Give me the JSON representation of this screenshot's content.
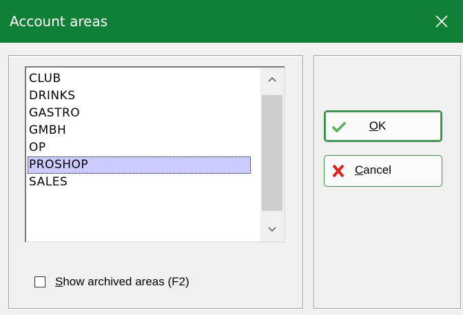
{
  "window": {
    "title": "Account areas",
    "close_icon": "close-icon"
  },
  "listbox": {
    "items": [
      "CLUB",
      "DRINKS",
      "GASTRO",
      "GMBH",
      "OP",
      "PROSHOP",
      "SALES"
    ],
    "selected_index": 5,
    "selected_value": "PROSHOP"
  },
  "checkbox": {
    "label_access_key": "S",
    "label_rest": "how archived areas (F2)",
    "checked": false
  },
  "buttons": {
    "ok": {
      "access_key": "O",
      "rest": "K",
      "icon": "checkmark-icon"
    },
    "cancel": {
      "access_key": "C",
      "rest": "ancel",
      "icon": "red-x-icon"
    }
  },
  "colors": {
    "titlebar": "#118037",
    "selection": "#cbcbff",
    "ok_check": "#2a9d2a",
    "cancel_x": "#e02020"
  }
}
